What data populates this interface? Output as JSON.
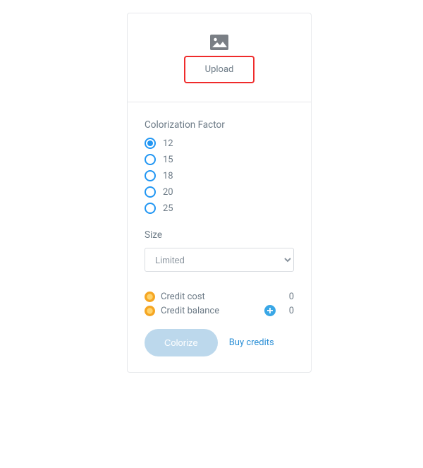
{
  "upload": {
    "label": "Upload"
  },
  "colorization": {
    "label": "Colorization Factor",
    "selected": 0,
    "options": [
      "12",
      "15",
      "18",
      "20",
      "25"
    ]
  },
  "size": {
    "label": "Size",
    "selected": "Limited"
  },
  "credits": {
    "cost_label": "Credit cost",
    "cost_value": "0",
    "balance_label": "Credit balance",
    "balance_value": "0"
  },
  "actions": {
    "colorize": "Colorize",
    "buy": "Buy credits"
  }
}
